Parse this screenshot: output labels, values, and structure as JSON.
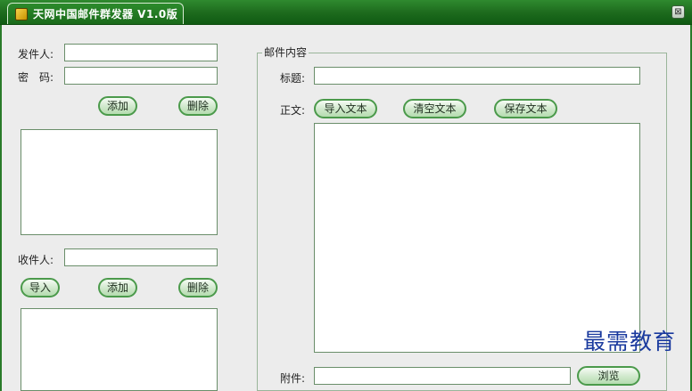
{
  "window": {
    "title": "天网中国邮件群发器 V1.0版",
    "app_icon": "app-icon",
    "close_icon": "close-icon",
    "close_glyph": "⊠"
  },
  "sender_panel": {
    "sender_label": "发件人:",
    "sender_value": "",
    "password_label": "密　码:",
    "password_value": "",
    "add_label": "添加",
    "delete_label": "删除",
    "sender_list": []
  },
  "recipient_panel": {
    "recipient_label": "收件人:",
    "recipient_value": "",
    "import_label": "导入",
    "add_label": "添加",
    "delete_label": "删除",
    "recipient_list": []
  },
  "mail_content": {
    "group_title": "邮件内容",
    "subject_label": "标题:",
    "subject_value": "",
    "body_label": "正文:",
    "import_text_label": "导入文本",
    "clear_text_label": "清空文本",
    "save_text_label": "保存文本",
    "body_text": "",
    "attachment_label": "附件:",
    "attachment_value": "",
    "browse_label": "浏览"
  },
  "watermark": {
    "text": "最需教育"
  },
  "colors": {
    "title_bar": "#1e6c1e",
    "button_border": "#4b9a4b",
    "field_border": "#6a8e6a",
    "client_bg": "#ececec",
    "watermark": "#1a3a9e"
  }
}
